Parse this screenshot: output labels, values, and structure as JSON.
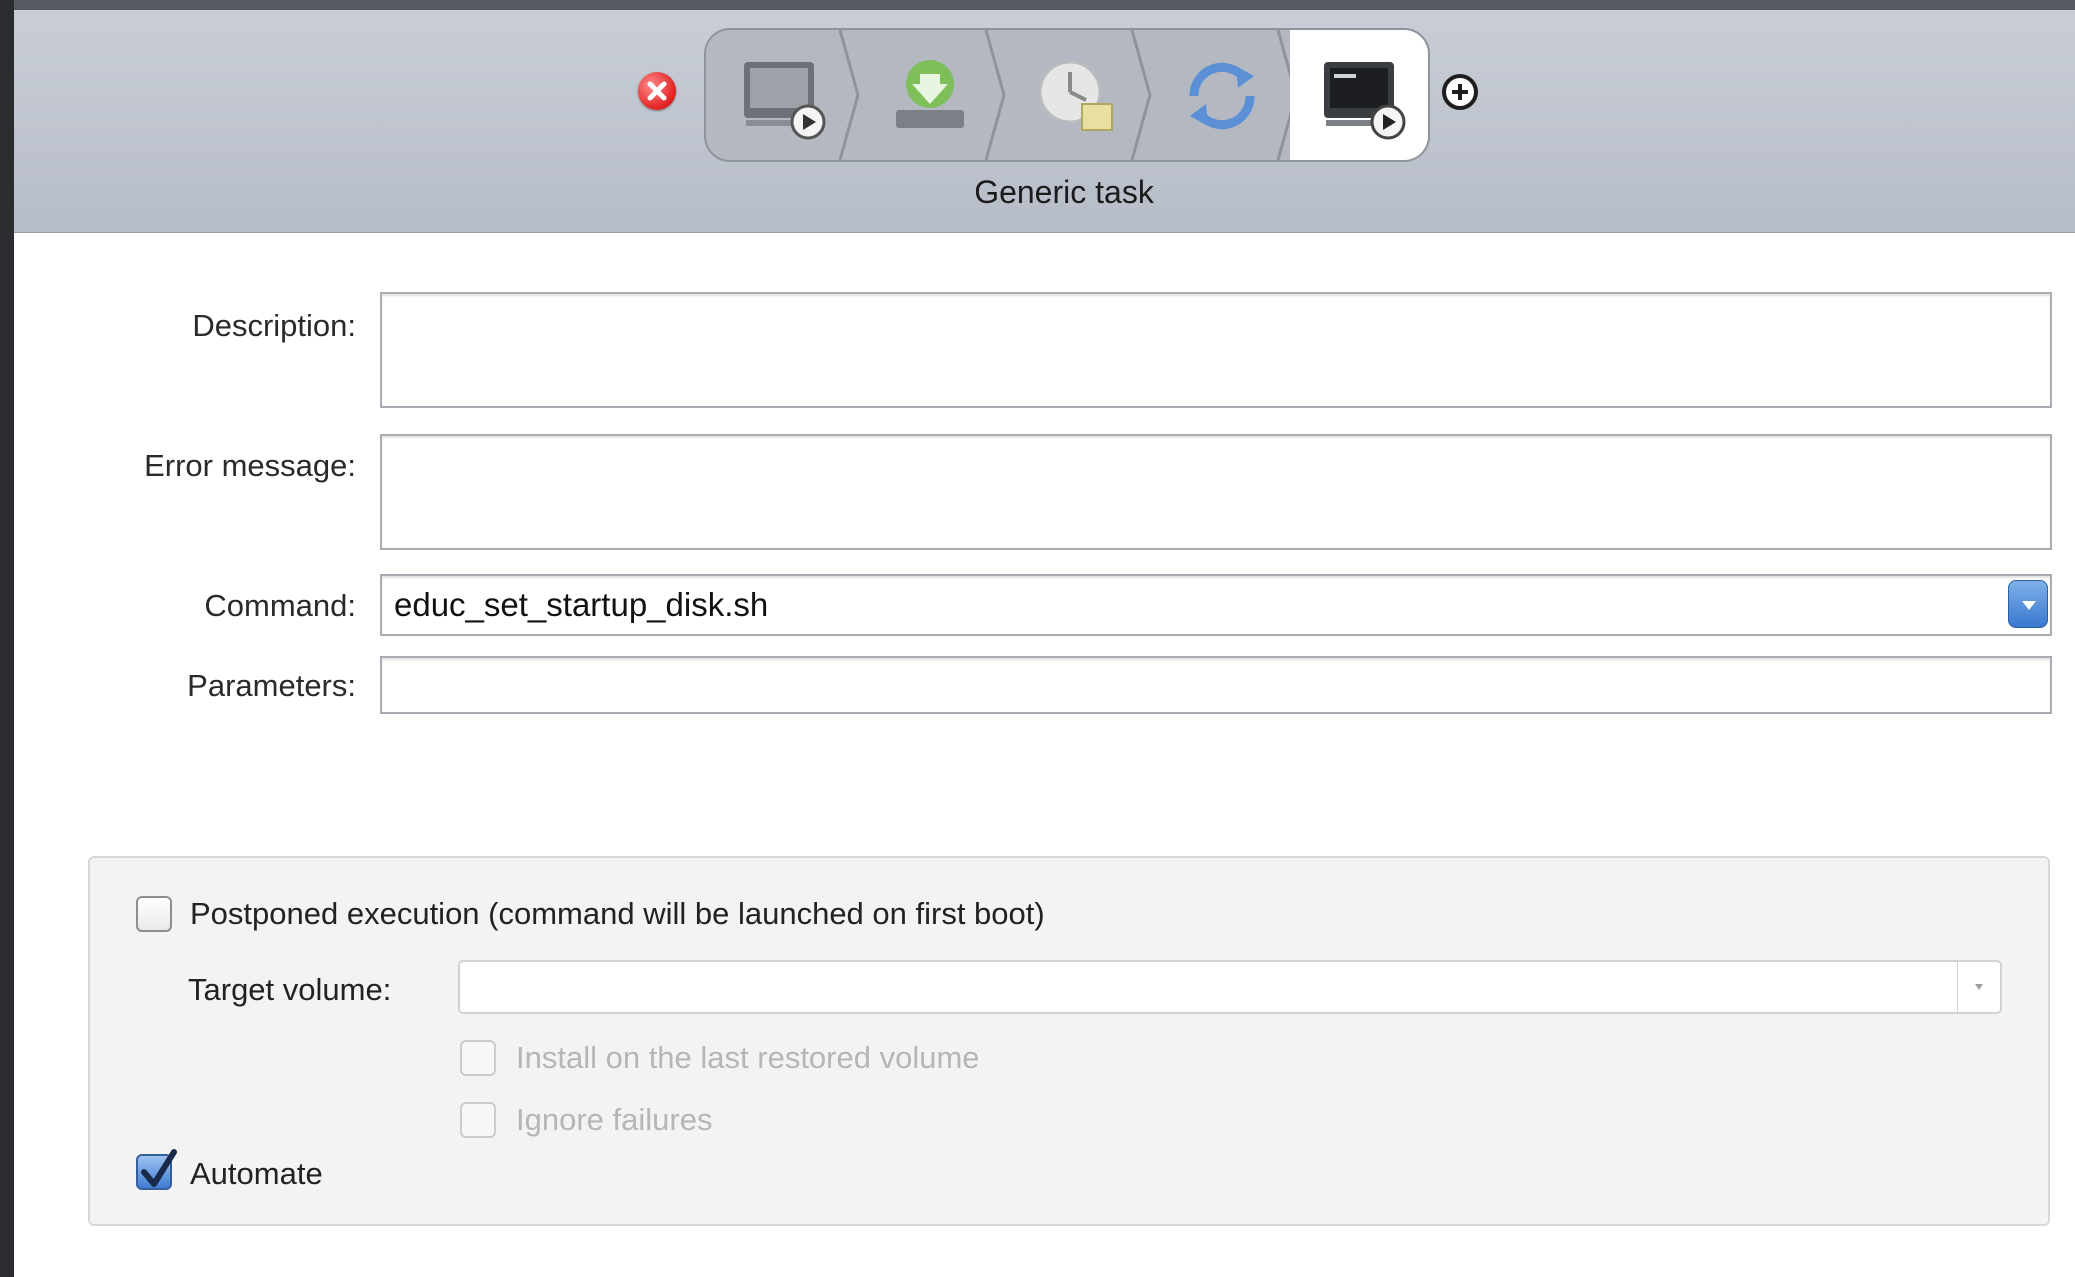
{
  "toolbar": {
    "remove_icon": "remove-circle-icon",
    "add_icon": "add-circle-icon",
    "steps": [
      {
        "icon": "script-terminal-icon",
        "active": false
      },
      {
        "icon": "download-install-icon",
        "active": false
      },
      {
        "icon": "clock-schedule-icon",
        "active": false
      },
      {
        "icon": "sync-arrows-icon",
        "active": false
      },
      {
        "icon": "script-terminal-icon",
        "active": true
      }
    ],
    "caption": "Generic task"
  },
  "form": {
    "description_label": "Description:",
    "description_value": "",
    "error_label": "Error message:",
    "error_value": "",
    "command_label": "Command:",
    "command_value": "educ_set_startup_disk.sh",
    "parameters_label": "Parameters:",
    "parameters_value": ""
  },
  "options": {
    "postponed_label": "Postponed execution (command will be launched on first boot)",
    "postponed_checked": false,
    "target_volume_label": "Target volume:",
    "target_volume_value": "",
    "install_last_label": "Install on the last restored volume",
    "install_last_checked": false,
    "ignore_failures_label": "Ignore failures",
    "ignore_failures_checked": false,
    "automate_label": "Automate",
    "automate_checked": true
  },
  "colors": {
    "accent": "#3a78cf",
    "remove": "#e02020",
    "toolbar_bg": "#c0c5ce"
  }
}
